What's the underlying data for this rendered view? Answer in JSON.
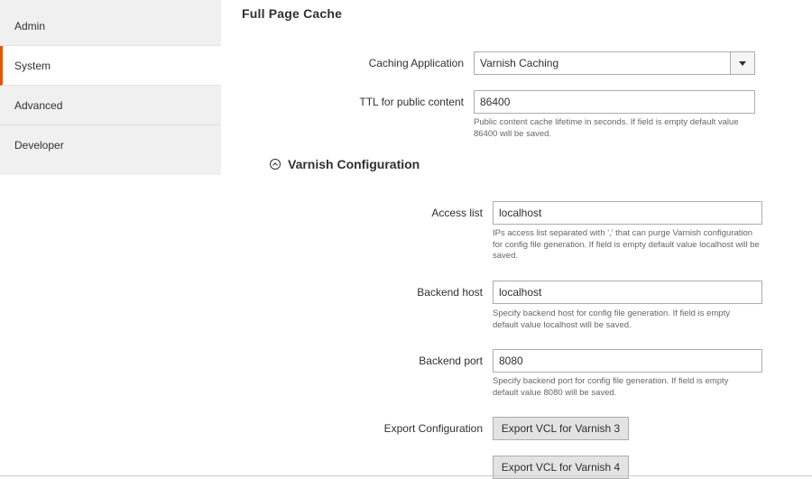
{
  "sidebar": {
    "items": [
      {
        "label": "Admin",
        "active": false
      },
      {
        "label": "System",
        "active": true
      },
      {
        "label": "Advanced",
        "active": false
      },
      {
        "label": "Developer",
        "active": false
      }
    ]
  },
  "section": {
    "title": "Full Page Cache",
    "caching_application": {
      "label": "Caching Application",
      "value": "Varnish Caching"
    },
    "ttl": {
      "label": "TTL for public content",
      "value": "86400",
      "note": "Public content cache lifetime in seconds. If field is empty default value 86400 will be saved."
    }
  },
  "varnish": {
    "title": "Varnish Configuration",
    "access_list": {
      "label": "Access list",
      "value": "localhost",
      "note": "IPs access list separated with ',' that can purge Varnish configuration for config file generation. If field is empty default value localhost will be saved."
    },
    "backend_host": {
      "label": "Backend host",
      "value": "localhost",
      "note": "Specify backend host for config file generation. If field is empty default value localhost will be saved."
    },
    "backend_port": {
      "label": "Backend port",
      "value": "8080",
      "note": "Specify backend port for config file generation. If field is empty default value 8080 will be saved."
    },
    "export": {
      "label": "Export Configuration",
      "button_v3": "Export VCL for Varnish 3",
      "button_v4": "Export VCL for Varnish 4"
    }
  },
  "colors": {
    "active_accent": "#eb5202",
    "sidebar_bg": "#f0f0f0"
  }
}
